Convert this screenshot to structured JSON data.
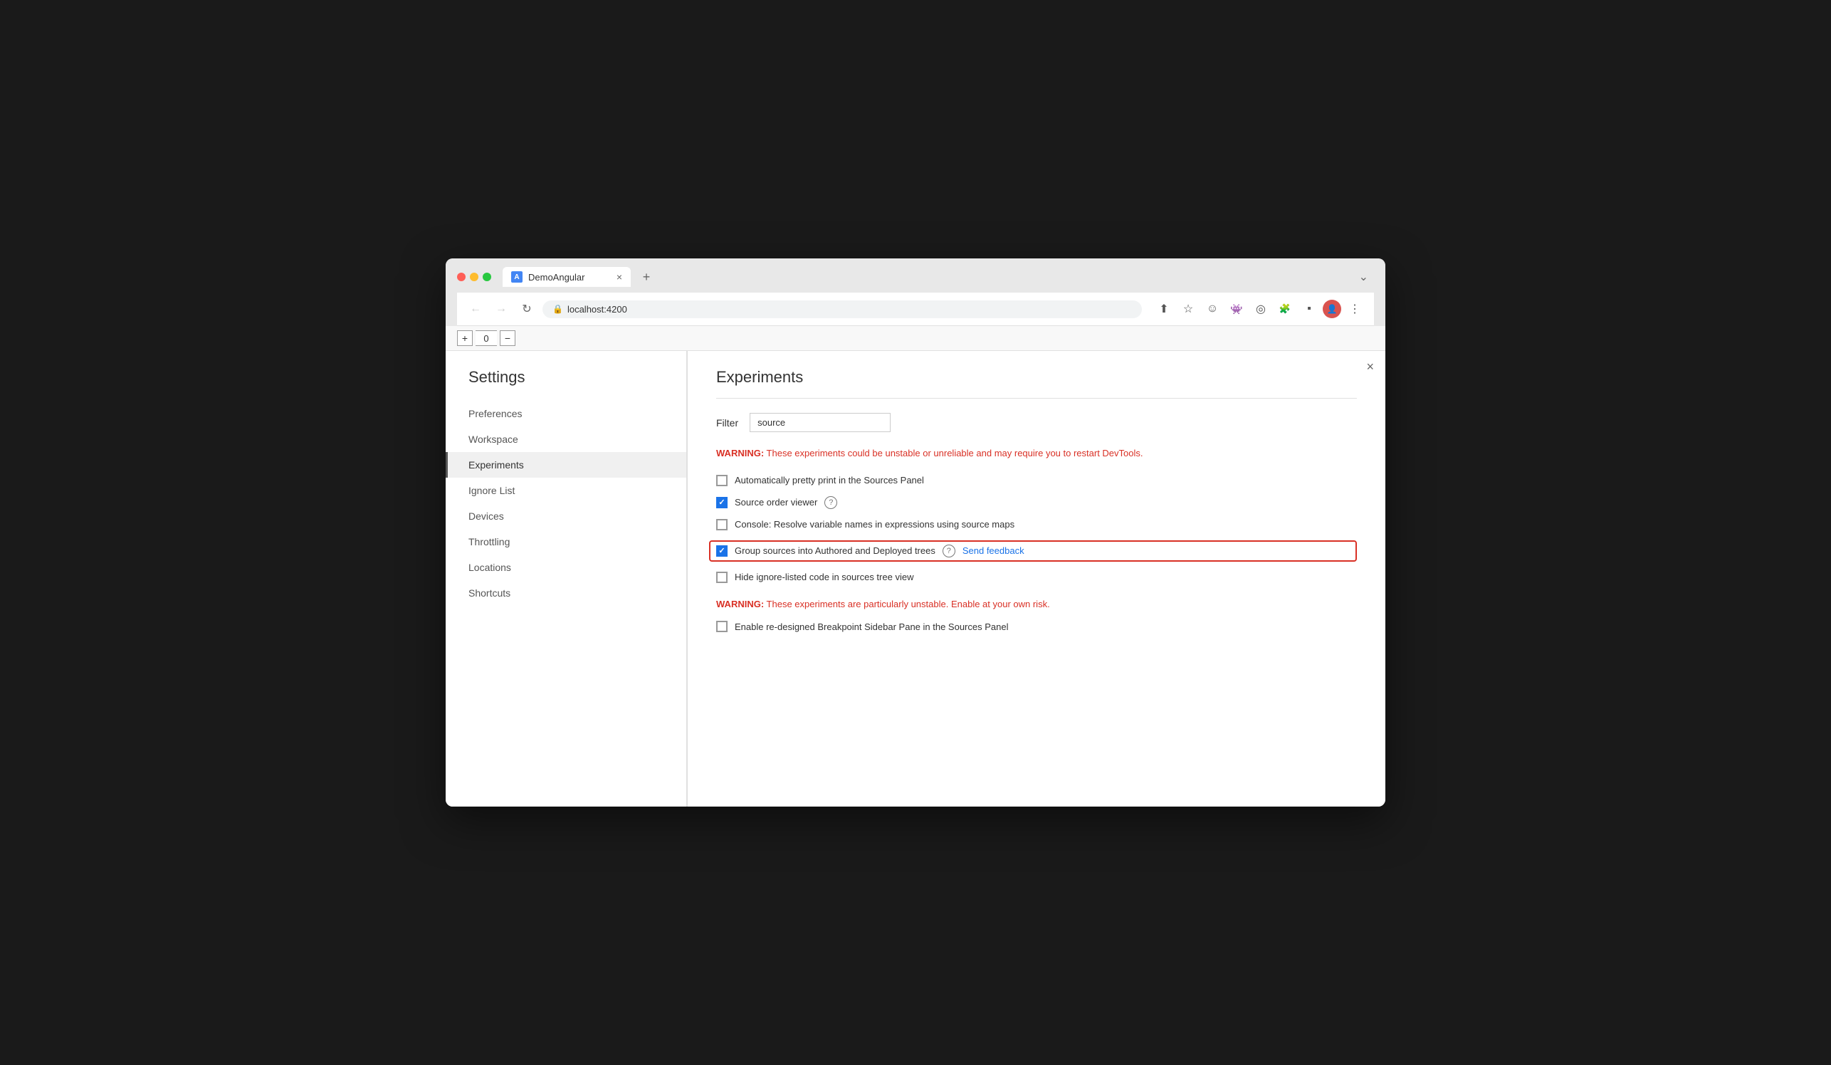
{
  "browser": {
    "tab_title": "DemoAngular",
    "tab_icon": "A",
    "tab_close": "×",
    "new_tab": "+",
    "tab_expand": "⌄",
    "back_btn": "←",
    "forward_btn": "→",
    "refresh_btn": "↻",
    "address_bar_text": "localhost:4200",
    "address_lock_icon": "🔒"
  },
  "toolbar_icons": [
    "↑",
    "☆",
    "☺",
    "👾",
    "☽",
    "🧩",
    "⬛",
    "👤",
    "⋮"
  ],
  "devtools_counter": {
    "minus": "−",
    "value": "0",
    "plus": "+"
  },
  "close_btn": "×",
  "settings": {
    "title": "Settings",
    "nav_items": [
      {
        "id": "preferences",
        "label": "Preferences",
        "active": false
      },
      {
        "id": "workspace",
        "label": "Workspace",
        "active": false
      },
      {
        "id": "experiments",
        "label": "Experiments",
        "active": true
      },
      {
        "id": "ignore-list",
        "label": "Ignore List",
        "active": false
      },
      {
        "id": "devices",
        "label": "Devices",
        "active": false
      },
      {
        "id": "throttling",
        "label": "Throttling",
        "active": false
      },
      {
        "id": "locations",
        "label": "Locations",
        "active": false
      },
      {
        "id": "shortcuts",
        "label": "Shortcuts",
        "active": false
      }
    ]
  },
  "experiments": {
    "title": "Experiments",
    "filter_label": "Filter",
    "filter_placeholder": "",
    "filter_value": "source",
    "warning1": "WARNING:",
    "warning1_text": " These experiments could be unstable or unreliable and may require you to restart DevTools.",
    "items": [
      {
        "id": "pretty-print",
        "label": "Automatically pretty print in the Sources Panel",
        "checked": false,
        "highlighted": false,
        "has_help": false,
        "has_feedback": false
      },
      {
        "id": "source-order",
        "label": "Source order viewer",
        "checked": true,
        "highlighted": false,
        "has_help": true,
        "has_feedback": false
      },
      {
        "id": "console-resolve",
        "label": "Console: Resolve variable names in expressions using source maps",
        "checked": false,
        "highlighted": false,
        "has_help": false,
        "has_feedback": false
      },
      {
        "id": "group-sources",
        "label": "Group sources into Authored and Deployed trees",
        "checked": true,
        "highlighted": true,
        "has_help": true,
        "has_feedback": true,
        "feedback_label": "Send feedback"
      },
      {
        "id": "hide-ignore",
        "label": "Hide ignore-listed code in sources tree view",
        "checked": false,
        "highlighted": false,
        "has_help": false,
        "has_feedback": false
      }
    ],
    "warning2": "WARNING:",
    "warning2_text": " These experiments are particularly unstable. Enable at your own risk.",
    "unstable_items": [
      {
        "id": "breakpoint-sidebar",
        "label": "Enable re-designed Breakpoint Sidebar Pane in the Sources Panel",
        "checked": false
      }
    ]
  }
}
